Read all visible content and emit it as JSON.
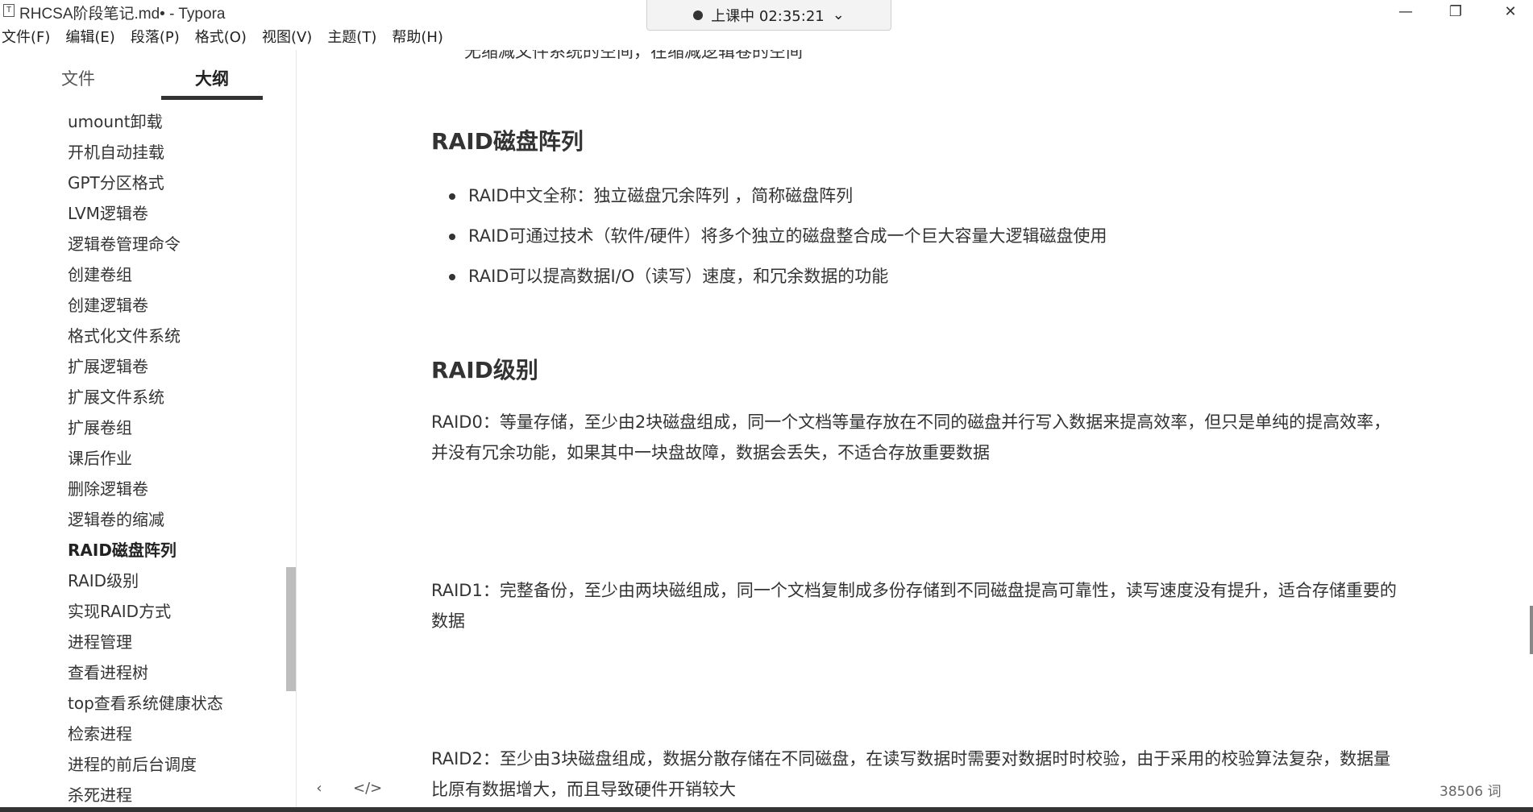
{
  "window": {
    "title": "RHCSA阶段笔记.md• - Typora",
    "app_icon": "T",
    "minimize_glyph": "—",
    "maximize_glyph": "❐",
    "close_glyph": "✕"
  },
  "timer": {
    "label": "上课中 02:35:21",
    "chevron": "⌄"
  },
  "menu": [
    "文件(F)",
    "编辑(E)",
    "段落(P)",
    "格式(O)",
    "视图(V)",
    "主题(T)",
    "帮助(H)"
  ],
  "sidebar": {
    "tab_files": "文件",
    "tab_outline": "大纲",
    "outline": [
      "umount卸载",
      "开机自动挂载",
      "GPT分区格式",
      "LVM逻辑卷",
      "逻辑卷管理命令",
      "创建卷组",
      "创建逻辑卷",
      "格式化文件系统",
      "扩展逻辑卷",
      "扩展文件系统",
      "扩展卷组",
      "课后作业",
      "删除逻辑卷",
      "逻辑卷的缩减",
      "RAID磁盘阵列",
      "RAID级别",
      "实现RAID方式",
      "进程管理",
      "查看进程树",
      "top查看系统健康状态",
      "检索进程",
      "进程的前后台调度",
      "杀死进程"
    ],
    "active_item": "RAID磁盘阵列"
  },
  "editor": {
    "cut_line": "无缩减文件系统的空间，在缩减逻辑卷的空间",
    "heading_raid": "RAID磁盘阵列",
    "bullets": [
      "RAID中文全称：独立磁盘冗余阵列 ，简称磁盘阵列",
      "RAID可通过技术（软件/硬件）将多个独立的磁盘整合成一个巨大容量大逻辑磁盘使用",
      "RAID可以提高数据I/O（读写）速度，和冗余数据的功能"
    ],
    "heading_level": "RAID级别",
    "raid0": "RAID0：等量存储，至少由2块磁盘组成，同一个文档等量存放在不同的磁盘并行写入数据来提高效率，但只是单纯的提高效率，并没有冗余功能，如果其中一块盘故障，数据会丢失，不适合存放重要数据",
    "raid1": "RAID1：完整备份，至少由两块磁组成，同一个文档复制成多份存储到不同磁盘提高可靠性，读写速度没有提升，适合存储重要的数据",
    "raid2": "RAID2：至少由3块磁盘组成，数据分散存储在不同磁盘，在读写数据时需要对数据时时校验，由于采用的校验算法复杂，数据量比原有数据增大，而且导致硬件开销较大"
  },
  "footer": {
    "back_glyph": "‹",
    "source_glyph": "</>",
    "word_count": "38506 词"
  }
}
